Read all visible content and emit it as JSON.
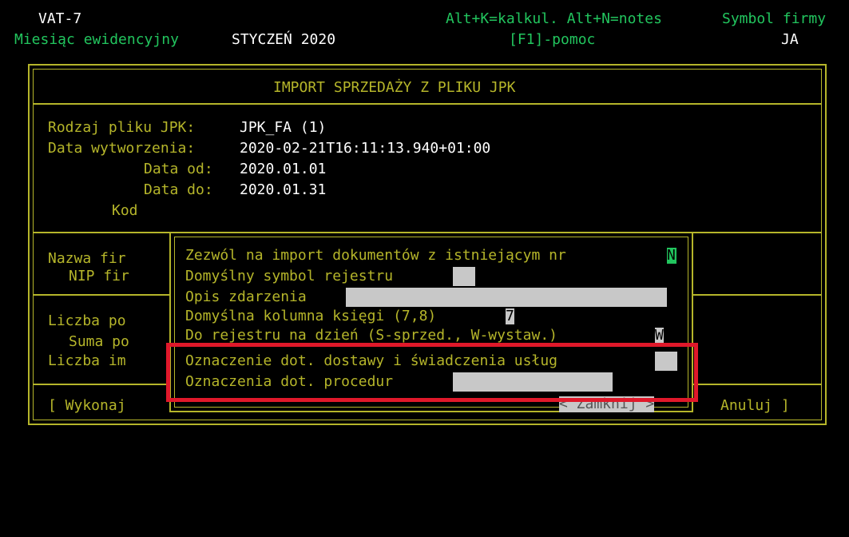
{
  "header": {
    "app": "VAT-7",
    "hint": "Alt+K=kalkul. Alt+N=notes",
    "symbol_label": "Symbol firmy",
    "month_label": "Miesiąc ewidencyjny",
    "month_value": "STYCZEŃ 2020",
    "help": "[F1]-pomoc",
    "company": "JA"
  },
  "main": {
    "title": "IMPORT SPRZEDAŻY Z PLIKU JPK",
    "rows": [
      {
        "label": "Rodzaj pliku JPK:",
        "value": "JPK_FA (1)"
      },
      {
        "label": "Data wytworzenia:",
        "value": "2020-02-21T16:11:13.940+01:00"
      },
      {
        "label": "Data od:",
        "value": "2020.01.01"
      },
      {
        "label": "Data do:",
        "value": "2020.01.31"
      },
      {
        "label": "Kod",
        "value": ""
      }
    ],
    "left_labels": [
      "Nazwa fir",
      "NIP fir",
      "Liczba po",
      "Suma po",
      "Liczba im"
    ],
    "execute_button": "[ Wykonaj",
    "cancel_button": "Anuluj ]"
  },
  "dialog": {
    "items": [
      {
        "label": "Zezwól na import dokumentów z istniejącym nr",
        "value": "N"
      },
      {
        "label": "Domyślny symbol rejestru",
        "value": ""
      },
      {
        "label": "Opis zdarzenia",
        "value": ""
      },
      {
        "label": "Domyślna kolumna księgi (7,8)",
        "value": "7"
      },
      {
        "label": "Do rejestru na dzień (S-sprzed., W-wystaw.)",
        "value": "W"
      },
      {
        "label": "Oznaczenie dot. dostawy i świadczenia usług",
        "value": ""
      },
      {
        "label": "Oznaczenia dot. procedur",
        "value": ""
      }
    ],
    "close_button": "< Zamknij >"
  },
  "colors": {
    "text": "#b5b52a",
    "accent": "#22c55e",
    "highlight": "#e0182a",
    "field": "#c8c8c8"
  }
}
